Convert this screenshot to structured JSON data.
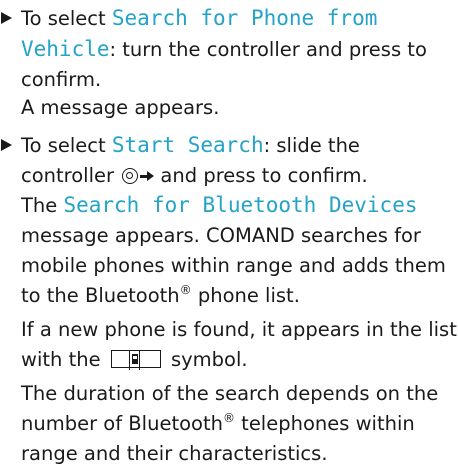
{
  "step1": {
    "bullet_icon": "triangle-bullet-icon",
    "text_before": "To select ",
    "display_term": "Search for Phone from Vehicle",
    "text_after": ": turn the controller and press to confirm.",
    "result": "A message appears."
  },
  "step2": {
    "bullet_icon": "triangle-bullet-icon",
    "text_before": "To select ",
    "display_term": "Start Search",
    "text_mid": ": slide the controller",
    "controller_icon": "controller-icon",
    "slide_icon": "slide-right-arrow-icon",
    "text_after": " and press to confirm.",
    "result_term": "Search for Bluetooth Devices",
    "result_text": " message appears. COMAND searches for mobile phones within range and adds them to the Bluetooth",
    "result_sup": "®",
    "result_end": " phone list.",
    "result_prefix": "The ",
    "note1_before": "If a new phone is found, it appears in the list with the",
    "note1_icon": "phone-symbol-icon",
    "note1_after": " symbol.",
    "note2_before": "The duration of the search depends on the number of Bluetooth",
    "note2_sup": "®",
    "note2_after": " telephones within range and their characteristics."
  },
  "colors": {
    "display_term": "#22a3c7",
    "text": "#1a1a1a"
  }
}
